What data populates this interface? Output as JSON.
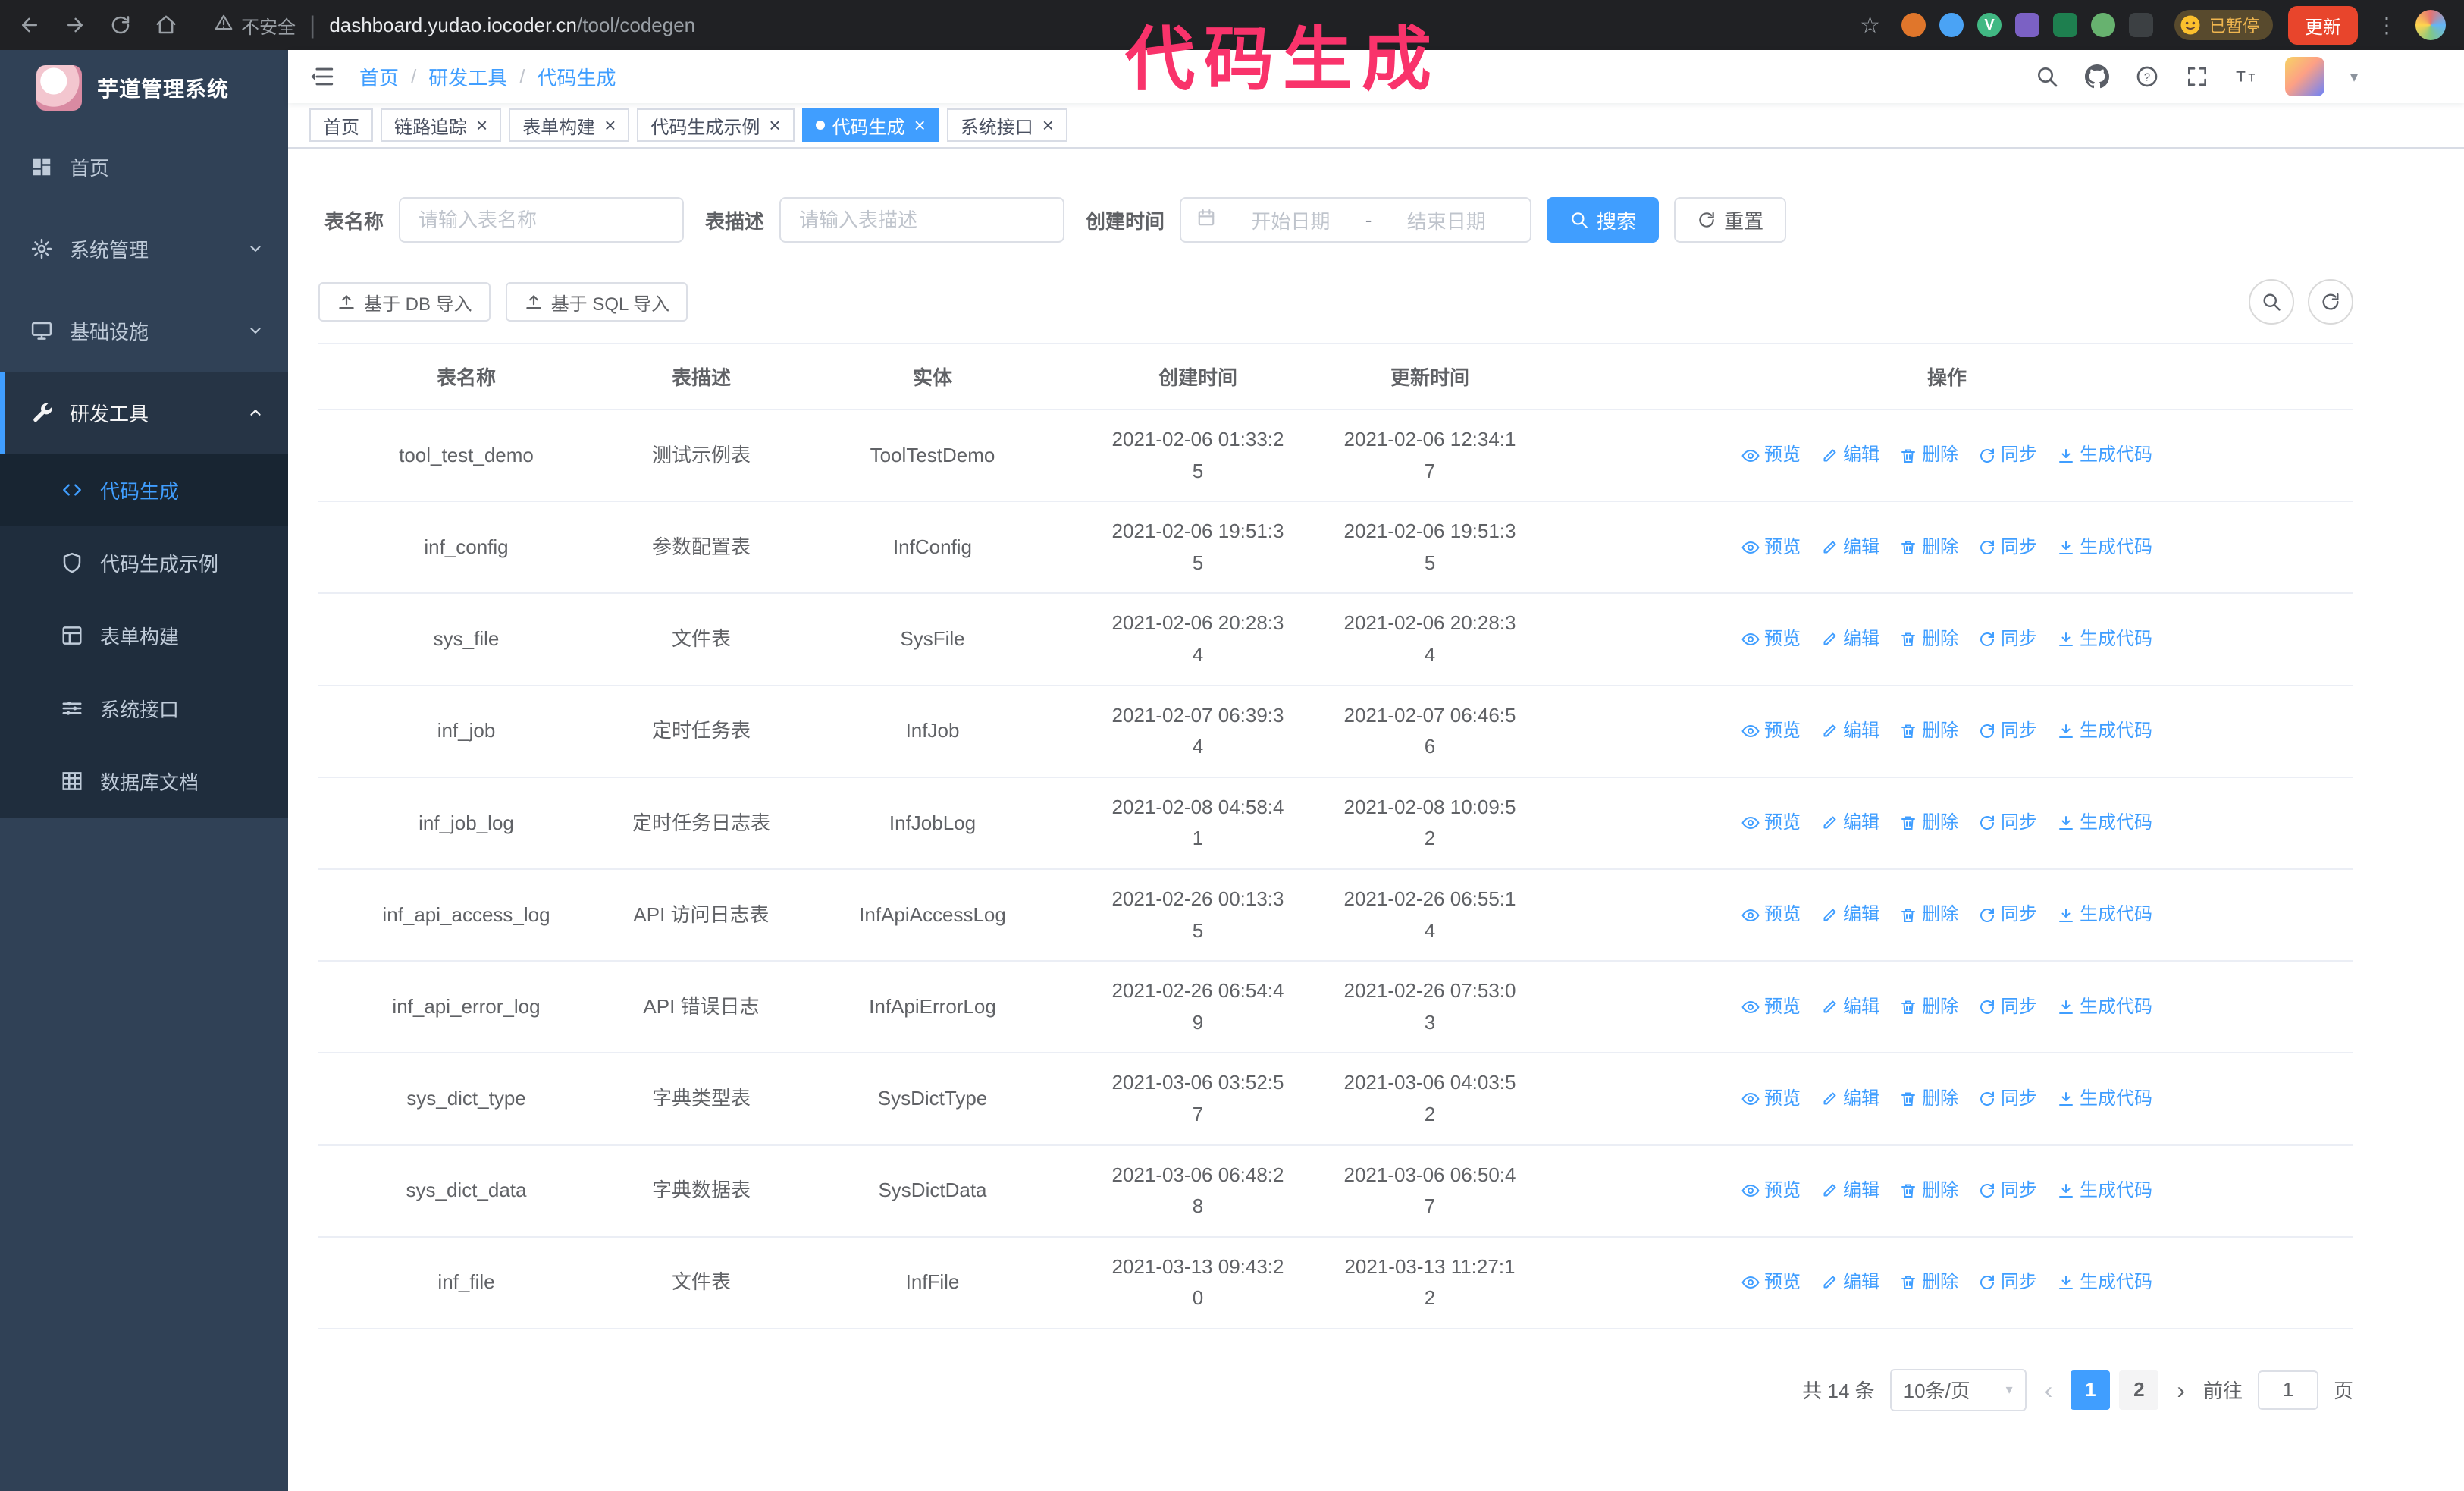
{
  "colors": {
    "accent": "#409eff",
    "sidebar_bg": "#304156",
    "submenu_bg": "#1f2d3d",
    "chrome_bg": "#202124",
    "overlay_title": "#f9336b",
    "tab_active_bg": "#409eff",
    "update_button": "#e8452c",
    "paused_badge_text": "#f0b64f",
    "link_color": "#409eff"
  },
  "overlay": {
    "title": "代码生成"
  },
  "browser": {
    "warning_text": "不安全",
    "url_host": "dashboard.yudao.iocoder.cn",
    "url_path": "/tool/codegen",
    "paused_badge": "已暂停",
    "update_label": "更新",
    "extensions": [
      {
        "name": "extension-orange",
        "color": "#e0762b",
        "shape": "circle",
        "glyph": ""
      },
      {
        "name": "extension-blue-drop",
        "color": "#4aa3f5",
        "shape": "circle",
        "glyph": ""
      },
      {
        "name": "extension-vue-devtools",
        "color": "#41b883",
        "shape": "circle",
        "glyph": "V"
      },
      {
        "name": "extension-colorful",
        "color": "#7b61c4",
        "shape": "square",
        "glyph": ""
      },
      {
        "name": "extension-green-box",
        "color": "#1e7f4f",
        "shape": "square",
        "glyph": ""
      },
      {
        "name": "extension-leaf",
        "color": "#67b26f",
        "shape": "circle",
        "glyph": ""
      },
      {
        "name": "extension-puzzle",
        "color": "#3c4043",
        "shape": "square",
        "glyph": ""
      }
    ]
  },
  "sidebar": {
    "logo_title": "芋道管理系统",
    "menu": [
      {
        "key": "home",
        "icon": "home",
        "label": "首页",
        "type": "item"
      },
      {
        "key": "system",
        "icon": "gear",
        "label": "系统管理",
        "type": "group",
        "state": "collapsed"
      },
      {
        "key": "infra",
        "icon": "monitor",
        "label": "基础设施",
        "type": "group",
        "state": "collapsed"
      },
      {
        "key": "devtools",
        "icon": "tools",
        "label": "研发工具",
        "type": "group",
        "state": "expanded",
        "active": true
      }
    ],
    "submenu": [
      {
        "key": "codegen",
        "icon": "code",
        "label": "代码生成",
        "active": true
      },
      {
        "key": "codegen-demo",
        "icon": "shield",
        "label": "代码生成示例"
      },
      {
        "key": "form-builder",
        "icon": "form",
        "label": "表单构建"
      },
      {
        "key": "api",
        "icon": "sliders",
        "label": "系统接口"
      },
      {
        "key": "db-doc",
        "icon": "grid",
        "label": "数据库文档"
      }
    ]
  },
  "header": {
    "breadcrumb": [
      "首页",
      "研发工具",
      "代码生成"
    ],
    "separator": "/"
  },
  "tabs": [
    {
      "key": "home",
      "label": "首页",
      "closable": false
    },
    {
      "key": "tracing",
      "label": "链路追踪",
      "closable": true
    },
    {
      "key": "form-builder",
      "label": "表单构建",
      "closable": true
    },
    {
      "key": "codegen-demo",
      "label": "代码生成示例",
      "closable": true
    },
    {
      "key": "codegen",
      "label": "代码生成",
      "closable": true,
      "active": true
    },
    {
      "key": "api",
      "label": "系统接口",
      "closable": true
    }
  ],
  "filters": {
    "table_name_label": "表名称",
    "table_name_placeholder": "请输入表名称",
    "table_desc_label": "表描述",
    "table_desc_placeholder": "请输入表描述",
    "create_time_label": "创建时间",
    "start_date_placeholder": "开始日期",
    "range_separator": "-",
    "end_date_placeholder": "结束日期",
    "search_label": "搜索",
    "reset_label": "重置"
  },
  "toolbar": {
    "import_db_label": "基于 DB 导入",
    "import_sql_label": "基于 SQL 导入"
  },
  "table": {
    "columns": [
      "表名称",
      "表描述",
      "实体",
      "创建时间",
      "更新时间",
      "操作"
    ],
    "actions": [
      {
        "key": "preview",
        "icon": "eye",
        "label": "预览"
      },
      {
        "key": "edit",
        "icon": "edit",
        "label": "编辑"
      },
      {
        "key": "delete",
        "icon": "trash",
        "label": "删除"
      },
      {
        "key": "sync",
        "icon": "sync",
        "label": "同步"
      },
      {
        "key": "generate-code",
        "icon": "download",
        "label": "生成代码"
      }
    ],
    "rows": [
      {
        "name": "tool_test_demo",
        "desc": "测试示例表",
        "entity": "ToolTestDemo",
        "created": "2021-02-06 01:33:25",
        "updated": "2021-02-06 12:34:17"
      },
      {
        "name": "inf_config",
        "desc": "参数配置表",
        "entity": "InfConfig",
        "created": "2021-02-06 19:51:35",
        "updated": "2021-02-06 19:51:35"
      },
      {
        "name": "sys_file",
        "desc": "文件表",
        "entity": "SysFile",
        "created": "2021-02-06 20:28:34",
        "updated": "2021-02-06 20:28:34"
      },
      {
        "name": "inf_job",
        "desc": "定时任务表",
        "entity": "InfJob",
        "created": "2021-02-07 06:39:34",
        "updated": "2021-02-07 06:46:56"
      },
      {
        "name": "inf_job_log",
        "desc": "定时任务日志表",
        "entity": "InfJobLog",
        "created": "2021-02-08 04:58:41",
        "updated": "2021-02-08 10:09:52"
      },
      {
        "name": "inf_api_access_log",
        "desc": "API 访问日志表",
        "entity": "InfApiAccessLog",
        "created": "2021-02-26 00:13:35",
        "updated": "2021-02-26 06:55:14"
      },
      {
        "name": "inf_api_error_log",
        "desc": "API 错误日志",
        "entity": "InfApiErrorLog",
        "created": "2021-02-26 06:54:49",
        "updated": "2021-02-26 07:53:03"
      },
      {
        "name": "sys_dict_type",
        "desc": "字典类型表",
        "entity": "SysDictType",
        "created": "2021-03-06 03:52:57",
        "updated": "2021-03-06 04:03:52"
      },
      {
        "name": "sys_dict_data",
        "desc": "字典数据表",
        "entity": "SysDictData",
        "created": "2021-03-06 06:48:28",
        "updated": "2021-03-06 06:50:47"
      },
      {
        "name": "inf_file",
        "desc": "文件表",
        "entity": "InfFile",
        "created": "2021-03-13 09:43:20",
        "updated": "2021-03-13 11:27:12"
      }
    ]
  },
  "pagination": {
    "total_text": "共 14 条",
    "page_size": "10条/页",
    "pages": [
      "1",
      "2"
    ],
    "current": "1",
    "goto_prefix": "前往",
    "goto_value": "1",
    "goto_suffix": "页"
  }
}
